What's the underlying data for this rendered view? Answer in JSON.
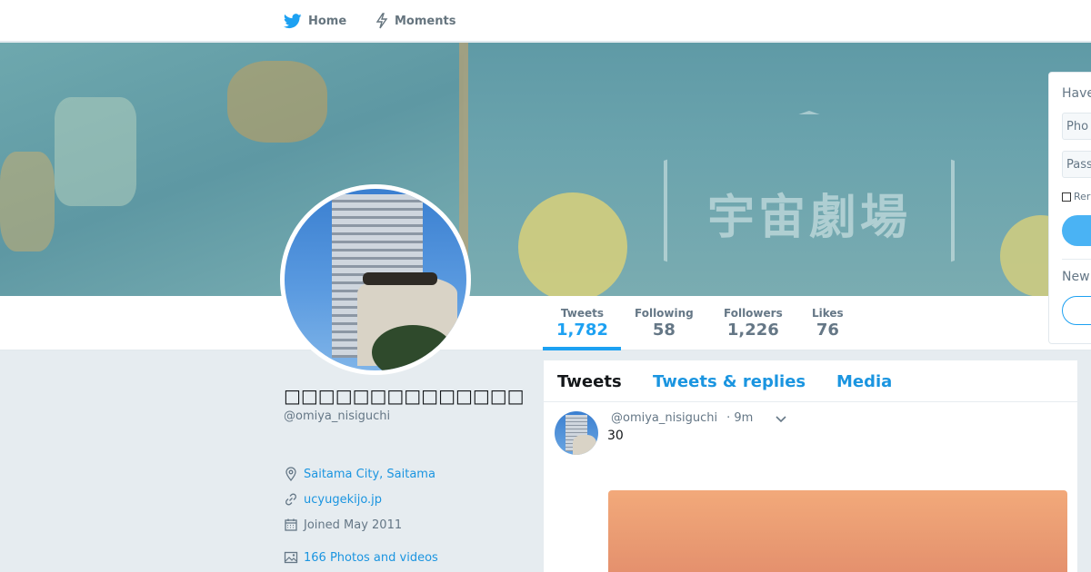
{
  "nav": {
    "home_label": "Home",
    "moments_label": "Moments"
  },
  "banner": {
    "sign_text": "宇宙劇場"
  },
  "profile": {
    "name": "□□□□□□□□□□□□□□",
    "handle": "@omiya_nisiguchi",
    "location": "Saitama City, Saitama",
    "url": "ucyugekijo.jp",
    "joined": "Joined May 2011",
    "photos": "166 Photos and videos"
  },
  "stats": [
    {
      "label": "Tweets",
      "value": "1,782"
    },
    {
      "label": "Following",
      "value": "58"
    },
    {
      "label": "Followers",
      "value": "1,226"
    },
    {
      "label": "Likes",
      "value": "76"
    }
  ],
  "timeline": {
    "tabs": [
      "Tweets",
      "Tweets & replies",
      "Media"
    ],
    "tweet": {
      "handle": "@omiya_nisiguchi",
      "time": "· 9m",
      "text": "30"
    }
  },
  "login": {
    "title": "Have",
    "phone_placeholder": "Pho",
    "password_placeholder": "Pass",
    "remember_label": "Rer",
    "new_label": "New"
  },
  "colors": {
    "accent": "#1da1f2",
    "link": "#1b95e0",
    "muted": "#657786",
    "background": "#e6ecf0"
  }
}
